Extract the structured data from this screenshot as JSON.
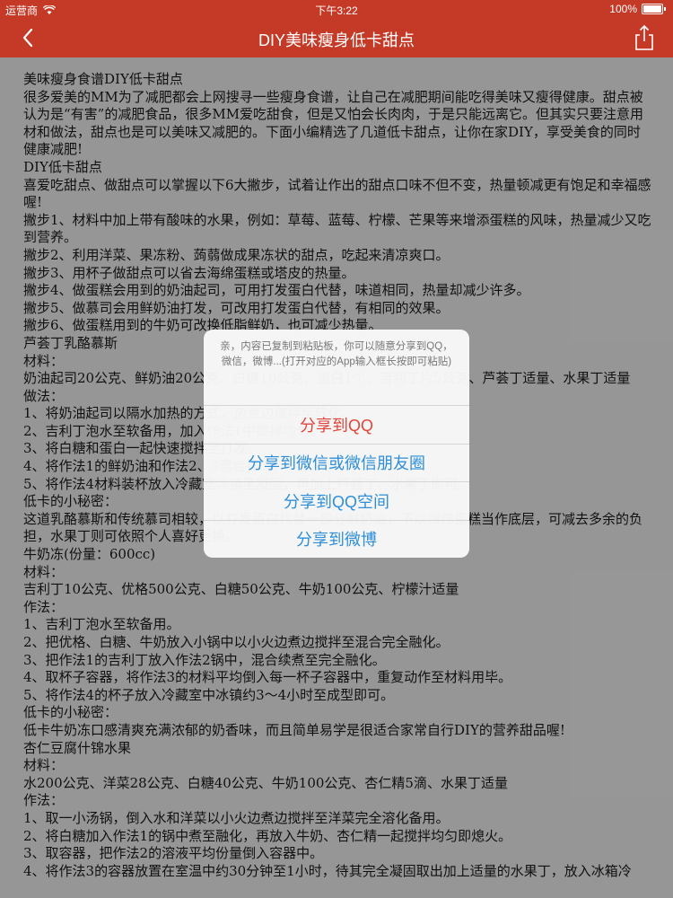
{
  "status_bar": {
    "carrier": "运营商",
    "time": "下午3:22",
    "battery_percent": "100%"
  },
  "nav": {
    "title": "DIY美味瘦身低卡甜点"
  },
  "article": {
    "lines": [
      "美味瘦身食谱DIY低卡甜点",
      "很多爱美的MM为了减肥都会上网搜寻一些瘦身食谱，让自己在减肥期间能吃得美味又瘦得健康。甜点被认为是“有害”的减肥食品，很多MM爱吃甜食，但是又怕会长肉肉，于是只能远离它。但其实只要注意用材和做法，甜点也是可以美味又减肥的。下面小编精选了几道低卡甜点，让你在家DIY，享受美食的同时健康减肥!",
      "DIY低卡甜点",
      "喜爱吃甜点、做甜点可以掌握以下6大撇步，试着让作出的甜点口味不但不变，热量顿减更有饱足和幸福感喔!",
      "撇步1、材料中加上带有酸味的水果，例如：草莓、蓝莓、柠檬、芒果等来增添蛋糕的风味，热量减少又吃到营养。",
      "撇步2、利用洋菜、果冻粉、蒟蒻做成果冻状的甜点，吃起来清凉爽口。",
      "撇步3、用杯子做甜点可以省去海绵蛋糕或塔皮的热量。",
      "撇步4、做蛋糕会用到的奶油起司，可用打发蛋白代替，味道相同，热量却减少许多。",
      "撇步5、做慕司会用鲜奶油打发，可改用打发蛋白代替，有相同的效果。",
      "撇步6、做蛋糕用到的牛奶可改换低脂鲜奶，也可减少热量。",
      "芦荟丁乳酪慕斯",
      "材料：",
      "奶油起司20公克、鲜奶油20公克、白糖10公克、蛋白1个、吉利丁片5公克、芦荟丁适量、水果丁适量",
      "做法：",
      "1、将奶油起司以隔水加热的方式，边煮边搅拌至软化。",
      "2、吉利丁泡水至软备用，加入作法1中搅拌均匀。",
      "3、将白糖和蛋白一起快速搅拌至打发。",
      "4、将作法1的鲜奶油和作法2、3混合拌匀。",
      "5、将作法4材料装杯放入冷藏室冰镇至凝固，再加上芦荟丁、水果丁即可。",
      "低卡的小秘密：",
      "这道乳酪慕斯和传统慕司相较，以打发蛋白代替一部分鲜奶油，不以海绵蛋糕当作底层，可减去多余的负担，水果丁则可依照个人喜好更换。",
      "牛奶冻(份量：600cc)",
      "材料：",
      "吉利丁10公克、优格500公克、白糖50公克、牛奶100公克、柠檬汁适量",
      "作法：",
      "1、吉利丁泡水至软备用。",
      "2、把优格、白糖、牛奶放入小锅中以小火边煮边搅拌至混合完全融化。",
      "3、把作法1的吉利丁放入作法2锅中，混合续煮至完全融化。",
      "4、取杯子容器，将作法3的材料平均倒入每一杯子容器中，重复动作至材料用毕。",
      "5、将作法4的杯子放入冷藏室中冰镇约3～4小时至成型即可。",
      "低卡的小秘密：",
      "低卡牛奶冻口感清爽充满浓郁的奶香味，而且简单易学是很适合家常自行DIY的营养甜品喔!",
      "杏仁豆腐什锦水果",
      "材料：",
      "水200公克、洋菜28公克、白糖40公克、牛奶100公克、杏仁精5滴、水果丁适量",
      "作法：",
      "1、取一小汤锅，倒入水和洋菜以小火边煮边搅拌至洋菜完全溶化备用。",
      "2、将白糖加入作法1的锅中煮至融化，再放入牛奶、杏仁精一起搅拌均匀即熄火。",
      "3、取容器，把作法2的溶液平均份量倒入容器中。",
      "4、将作法3的容器放置在室温中约30分钟至1小时，待其完全凝固取出加上适量的水果丁，放入冰箱冷"
    ]
  },
  "share_dialog": {
    "message": "亲，内容已复制到粘贴板，你可以随意分享到QQ，微信，微博...(打开对应的App输入框长按即可粘贴)",
    "buttons": [
      {
        "label": "分享到QQ"
      },
      {
        "label": "分享到微信或微信朋友圈"
      },
      {
        "label": "分享到QQ空间"
      },
      {
        "label": "分享到微博"
      }
    ],
    "colors": {
      "qq": "#e0453a",
      "default": "#2e8fd8"
    }
  },
  "theme": {
    "bar_color": "#c53a27"
  },
  "icons": {
    "back": "chevron-left-icon",
    "share": "share-icon",
    "wifi": "wifi-icon",
    "battery": "battery-icon"
  }
}
